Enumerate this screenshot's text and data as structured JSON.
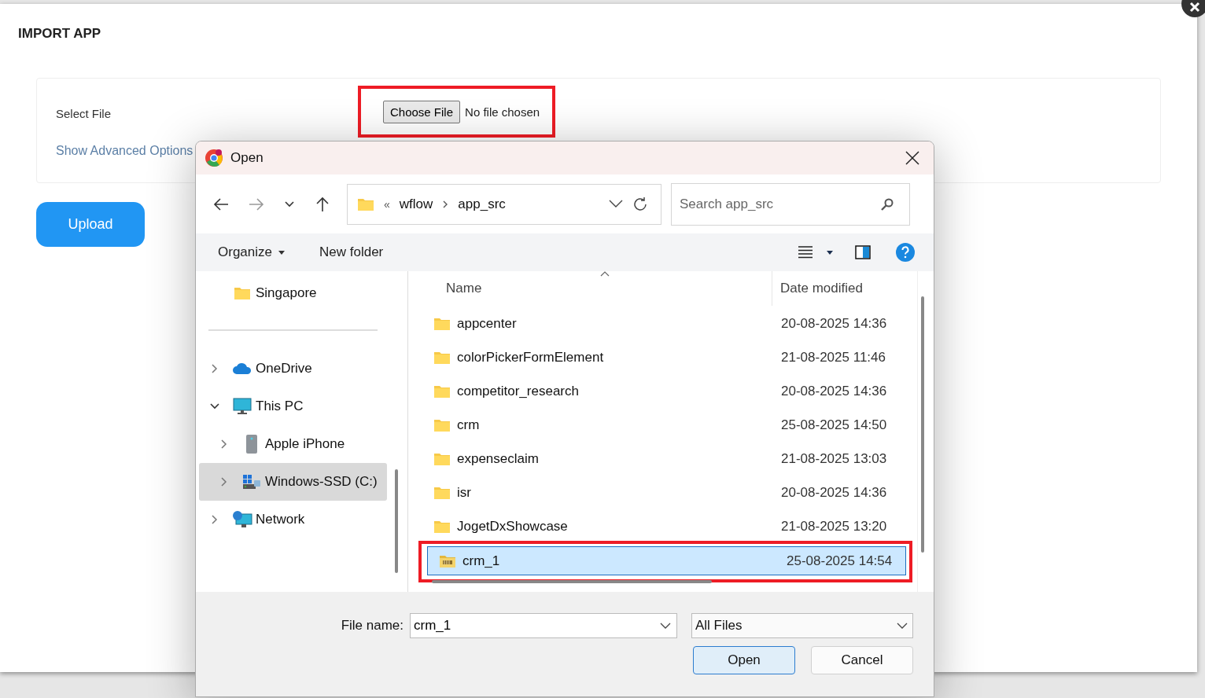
{
  "page": {
    "title": "IMPORT APP",
    "select_label": "Select File",
    "file_picker": {
      "button": "Choose File",
      "status": "No file chosen",
      "highlighted": true
    },
    "advanced_link": "Show Advanced Options",
    "upload_button": "Upload"
  },
  "dialog": {
    "title": "Open",
    "address": {
      "overflow": "«",
      "crumbs": [
        "wflow",
        "app_src"
      ]
    },
    "search": {
      "placeholder": "Search app_src"
    },
    "toolbar": {
      "organize": "Organize",
      "new_folder": "New folder"
    },
    "nav": [
      {
        "label": "Singapore",
        "kind": "folder",
        "selected": false
      },
      {
        "kind": "separator"
      },
      {
        "label": "OneDrive",
        "kind": "cloud",
        "expanded": false,
        "selected": false
      },
      {
        "label": "This PC",
        "kind": "computer",
        "expanded": true,
        "selected": false,
        "children": [
          {
            "label": "Apple iPhone",
            "kind": "phone",
            "expanded": false,
            "selected": false
          },
          {
            "label": "Windows-SSD (C:)",
            "kind": "drive",
            "expanded": false,
            "selected": true
          }
        ]
      },
      {
        "label": "Network",
        "kind": "network",
        "expanded": false,
        "selected": false
      }
    ],
    "columns": [
      "Name",
      "Date modified"
    ],
    "files": [
      {
        "name": "appcenter",
        "date": "20-08-2025 14:36",
        "kind": "folder",
        "selected": false,
        "highlighted": false
      },
      {
        "name": "colorPickerFormElement",
        "date": "21-08-2025 11:46",
        "kind": "folder",
        "selected": false,
        "highlighted": false
      },
      {
        "name": "competitor_research",
        "date": "20-08-2025 14:36",
        "kind": "folder",
        "selected": false,
        "highlighted": false
      },
      {
        "name": "crm",
        "date": "25-08-2025 14:50",
        "kind": "folder",
        "selected": false,
        "highlighted": false
      },
      {
        "name": "expenseclaim",
        "date": "21-08-2025 13:03",
        "kind": "folder",
        "selected": false,
        "highlighted": false
      },
      {
        "name": "isr",
        "date": "20-08-2025 14:36",
        "kind": "folder",
        "selected": false,
        "highlighted": false
      },
      {
        "name": "JogetDxShowcase",
        "date": "21-08-2025 13:20",
        "kind": "folder",
        "selected": false,
        "highlighted": false
      },
      {
        "name": "crm_1",
        "date": "25-08-2025 14:54",
        "kind": "zip",
        "selected": true,
        "highlighted": true
      }
    ],
    "footer": {
      "file_name_label": "File name:",
      "file_name": "crm_1",
      "file_type": "All Files",
      "open_button": "Open",
      "cancel_button": "Cancel"
    }
  }
}
